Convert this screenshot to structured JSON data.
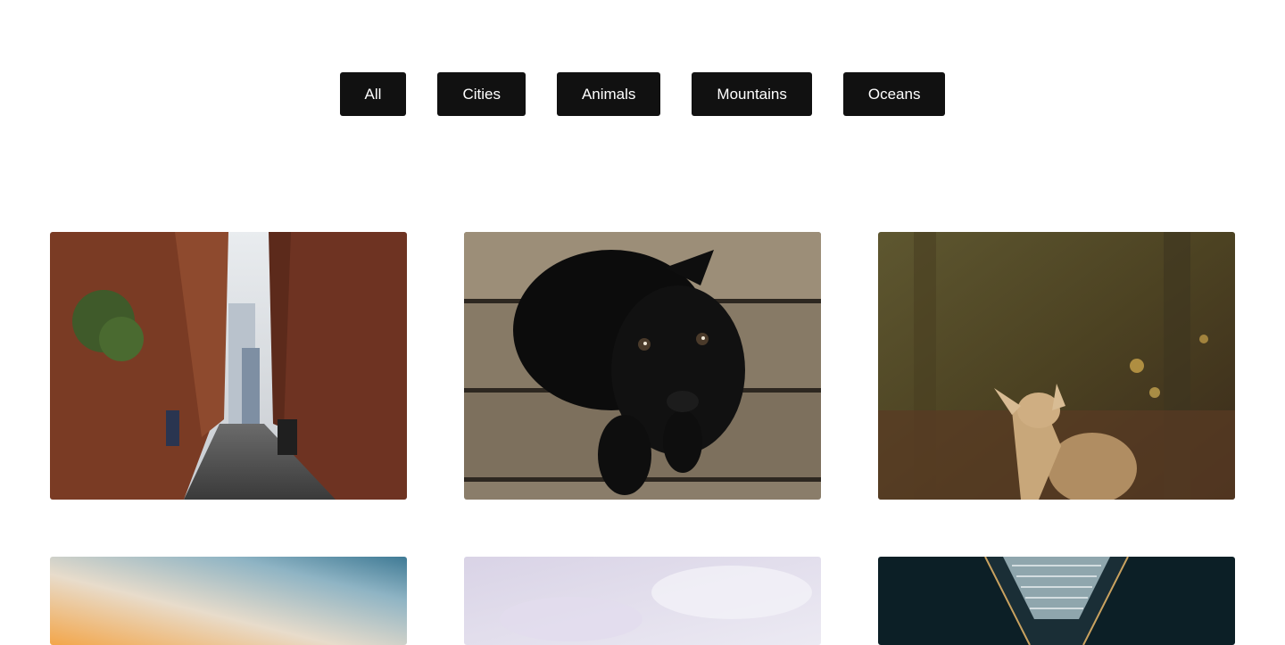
{
  "filters": {
    "items": [
      {
        "label": "All"
      },
      {
        "label": "Cities"
      },
      {
        "label": "Animals"
      },
      {
        "label": "Mountains"
      },
      {
        "label": "Oceans"
      }
    ]
  },
  "gallery": {
    "items": [
      {
        "subject": "brick-alley-photo"
      },
      {
        "subject": "black-puppy-photo"
      },
      {
        "subject": "deer-photo"
      },
      {
        "subject": "sunset-sky-photo"
      },
      {
        "subject": "cloudy-sky-photo"
      },
      {
        "subject": "glass-ceiling-photo"
      }
    ]
  },
  "colors": {
    "button_bg": "#111111",
    "button_text": "#ffffff",
    "page_bg": "#ffffff"
  }
}
